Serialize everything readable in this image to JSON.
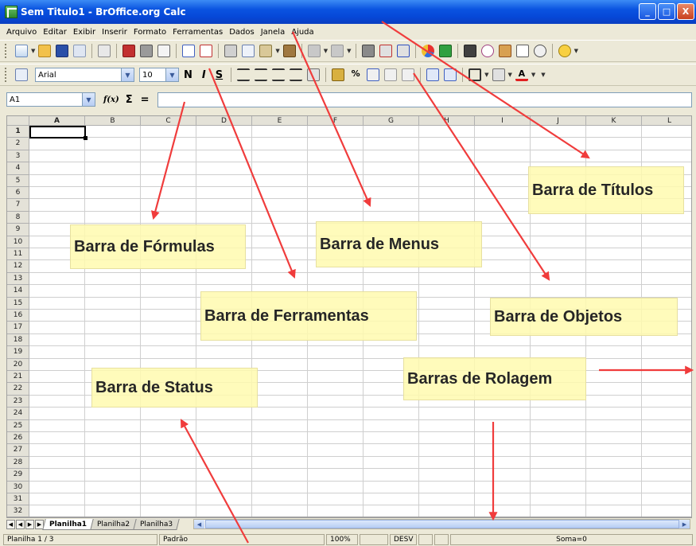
{
  "window": {
    "title": "Sem Titulo1 - BrOffice.org Calc",
    "controls": [
      "_",
      "□",
      "X"
    ]
  },
  "menu": [
    "Arquivo",
    "Editar",
    "Exibir",
    "Inserir",
    "Formato",
    "Ferramentas",
    "Dados",
    "Janela",
    "Ajuda"
  ],
  "format_toolbar": {
    "font_name": "Arial",
    "font_size": "10",
    "bold": "N",
    "italic": "I",
    "underline": "S"
  },
  "formula_bar": {
    "name_box": "A1",
    "function_icon": "f(x)",
    "sum_icon": "Σ",
    "equals_icon": "="
  },
  "grid": {
    "columns": [
      "A",
      "B",
      "C",
      "D",
      "E",
      "F",
      "G",
      "H",
      "I",
      "J",
      "K",
      "L"
    ],
    "rows": [
      "1",
      "2",
      "3",
      "4",
      "5",
      "6",
      "7",
      "8",
      "9",
      "10",
      "11",
      "12",
      "13",
      "14",
      "15",
      "16",
      "17",
      "18",
      "19",
      "20",
      "21",
      "22",
      "23",
      "24",
      "25",
      "26",
      "27",
      "28",
      "29",
      "30",
      "31",
      "32"
    ]
  },
  "sheet_tabs": [
    "Planilha1",
    "Planilha2",
    "Planilha3"
  ],
  "status_bar": {
    "sheet": "Planilha 1 / 3",
    "style": "Padrão",
    "zoom": "100%",
    "mode": "DESV",
    "sum": "Soma=0"
  },
  "annotations": {
    "formulas": "Barra de Fórmulas",
    "menus": "Barra de Menus",
    "titles": "Barra de Títulos",
    "tools": "Barra de Ferramentas",
    "objects": "Barra de Objetos",
    "status": "Barra de Status",
    "scroll": "Barras de Rolagem"
  },
  "colors": {
    "title_bar": "#0648d8",
    "callout": "#fffaaf",
    "arrow": "#f03c3c"
  }
}
